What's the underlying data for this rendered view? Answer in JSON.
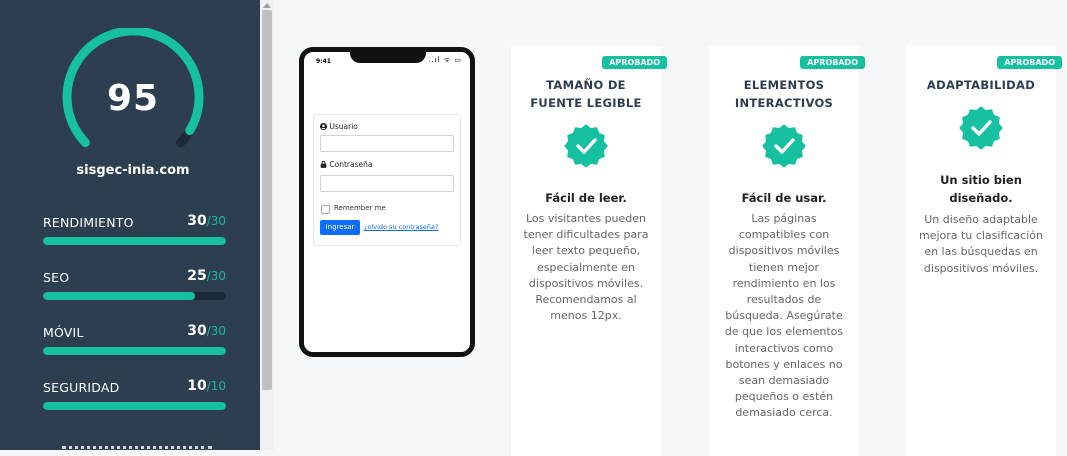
{
  "sidebar": {
    "score": "95",
    "score_value": 95,
    "domain": "sisgec-inia.com",
    "metrics": [
      {
        "label": "RENDIMIENTO",
        "value": "30",
        "max": "/30",
        "fraction": 1.0
      },
      {
        "label": "SEO",
        "value": "25",
        "max": "/30",
        "fraction": 0.833
      },
      {
        "label": "MÓVIL",
        "value": "30",
        "max": "/30",
        "fraction": 1.0
      },
      {
        "label": "SEGURIDAD",
        "value": "10",
        "max": "/10",
        "fraction": 1.0
      }
    ]
  },
  "phone": {
    "time": "9:41",
    "status": "..ıl ᯤ ▭",
    "user_label": "Usuario",
    "password_label": "Contraseña",
    "remember_label": "Remember me",
    "login_button": "Ingresar",
    "forgot_link": "¿olvido su contraseña?"
  },
  "cards": [
    {
      "badge": "APROBADO",
      "title": "TAMAÑO DE FUENTE LEGIBLE",
      "headline": "Fácil de leer.",
      "description": "Los visitantes pueden tener dificultades para leer texto pequeño, especialmente en dispositivos móviles. Recomendamos al menos 12px."
    },
    {
      "badge": "APROBADO",
      "title": "ELEMENTOS INTERACTIVOS",
      "headline": "Fácil de usar.",
      "description": "Las páginas compatibles con dispositivos móviles tienen mejor rendimiento en los resultados de búsqueda. Asegúrate de que los elementos interactivos como botones y enlaces no sean demasiado pequeños o estén demasiado cerca."
    },
    {
      "badge": "APROBADO",
      "title": "ADAPTABILIDAD",
      "headline": "Un sitio bien diseñado.",
      "description": "Un diseño adaptable mejora tu clasificación en las búsquedas en dispositivos móviles."
    }
  ],
  "colors": {
    "sidebar_bg": "#2c3e50",
    "accent": "#16c0a0",
    "gauge_track": "#1c2a37",
    "link_blue": "#0d6efd"
  }
}
